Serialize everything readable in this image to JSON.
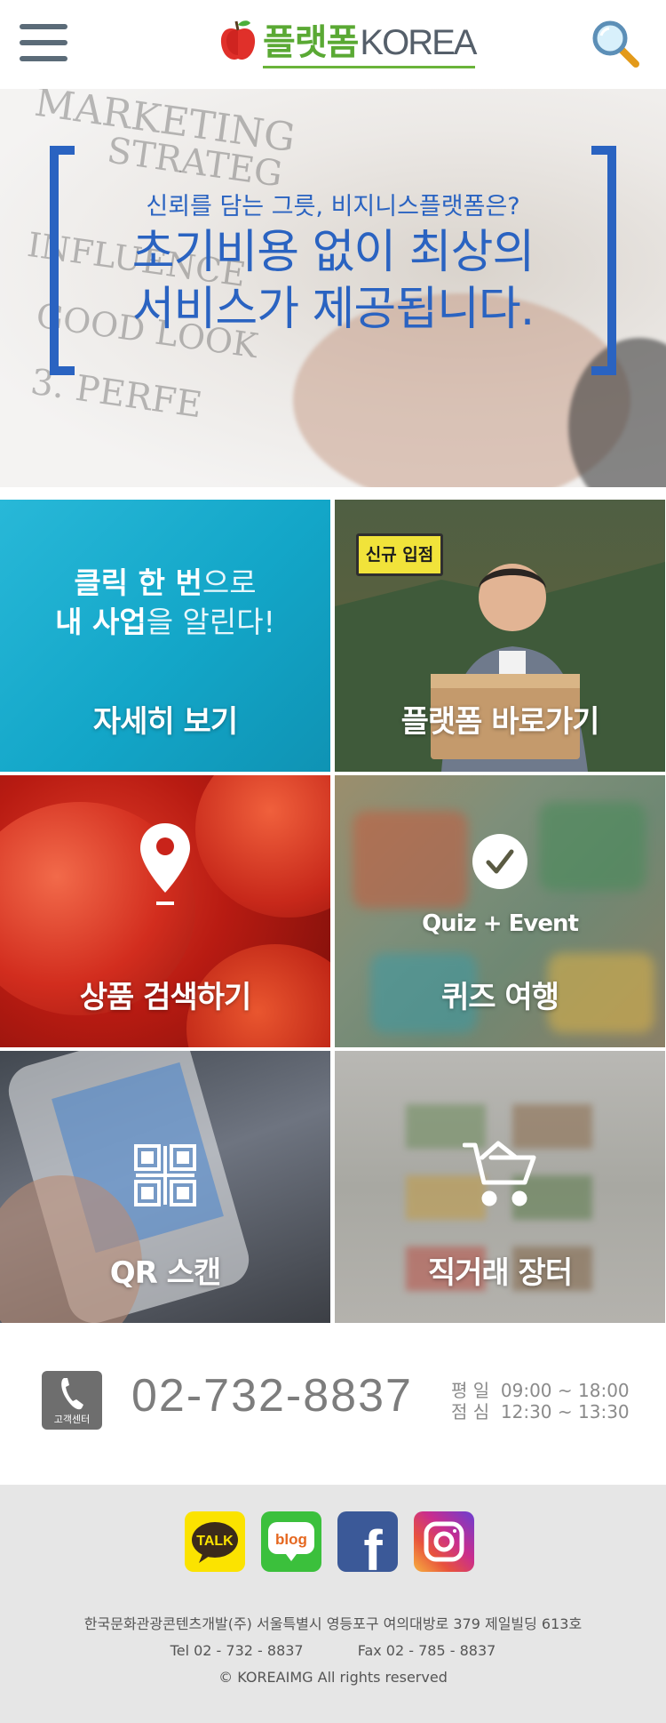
{
  "header": {
    "logo_korean": "플랫폼",
    "logo_english": "KOREA"
  },
  "hero": {
    "subtitle": "신뢰를 담는 그릇, 비지니스플랫폼은?",
    "title_line1": "초기비용 없이 최상의",
    "title_line2": "서비스가 제공됩니다."
  },
  "tiles": [
    {
      "label": "자세히 보기",
      "headline_bold1": "클릭 한 번",
      "headline_rest1": "으로",
      "headline_bold2": "내 사업",
      "headline_rest2": "을 알린다!"
    },
    {
      "label": "플랫폼 바로가기",
      "sign": "신규 입점"
    },
    {
      "label": "상품 검색하기",
      "icon": "map-pin-icon"
    },
    {
      "label": "퀴즈 여행",
      "caption": "Quiz + Event",
      "icon": "check-circle-icon"
    },
    {
      "label": "QR 스캔",
      "icon": "qr-code-icon"
    },
    {
      "label": "직거래 장터",
      "icon": "shopping-cart-icon"
    }
  ],
  "contact": {
    "icon_label": "고객센터",
    "phone": "02-732-8837",
    "weekday_label": "평 일",
    "weekday_hours": "09:00 ~ 18:00",
    "lunch_label": "점 심",
    "lunch_hours": "12:30 ~ 13:30"
  },
  "social": [
    {
      "name": "kakaotalk",
      "text": "TALK"
    },
    {
      "name": "naver-blog",
      "text": "blog"
    },
    {
      "name": "facebook",
      "text": "f"
    },
    {
      "name": "instagram",
      "text": ""
    }
  ],
  "footer": {
    "company": "한국문화관광콘텐츠개발(주) 서울특별시 영등포구 여의대방로 379 제일빌딩 613호",
    "tel": "Tel   02 - 732 - 8837",
    "fax": "Fax   02 - 785 - 8837",
    "copyright": "© KOREAIMG  All rights reserved"
  },
  "colors": {
    "brand_blue": "#2a63c1",
    "brand_green": "#5aa934"
  }
}
